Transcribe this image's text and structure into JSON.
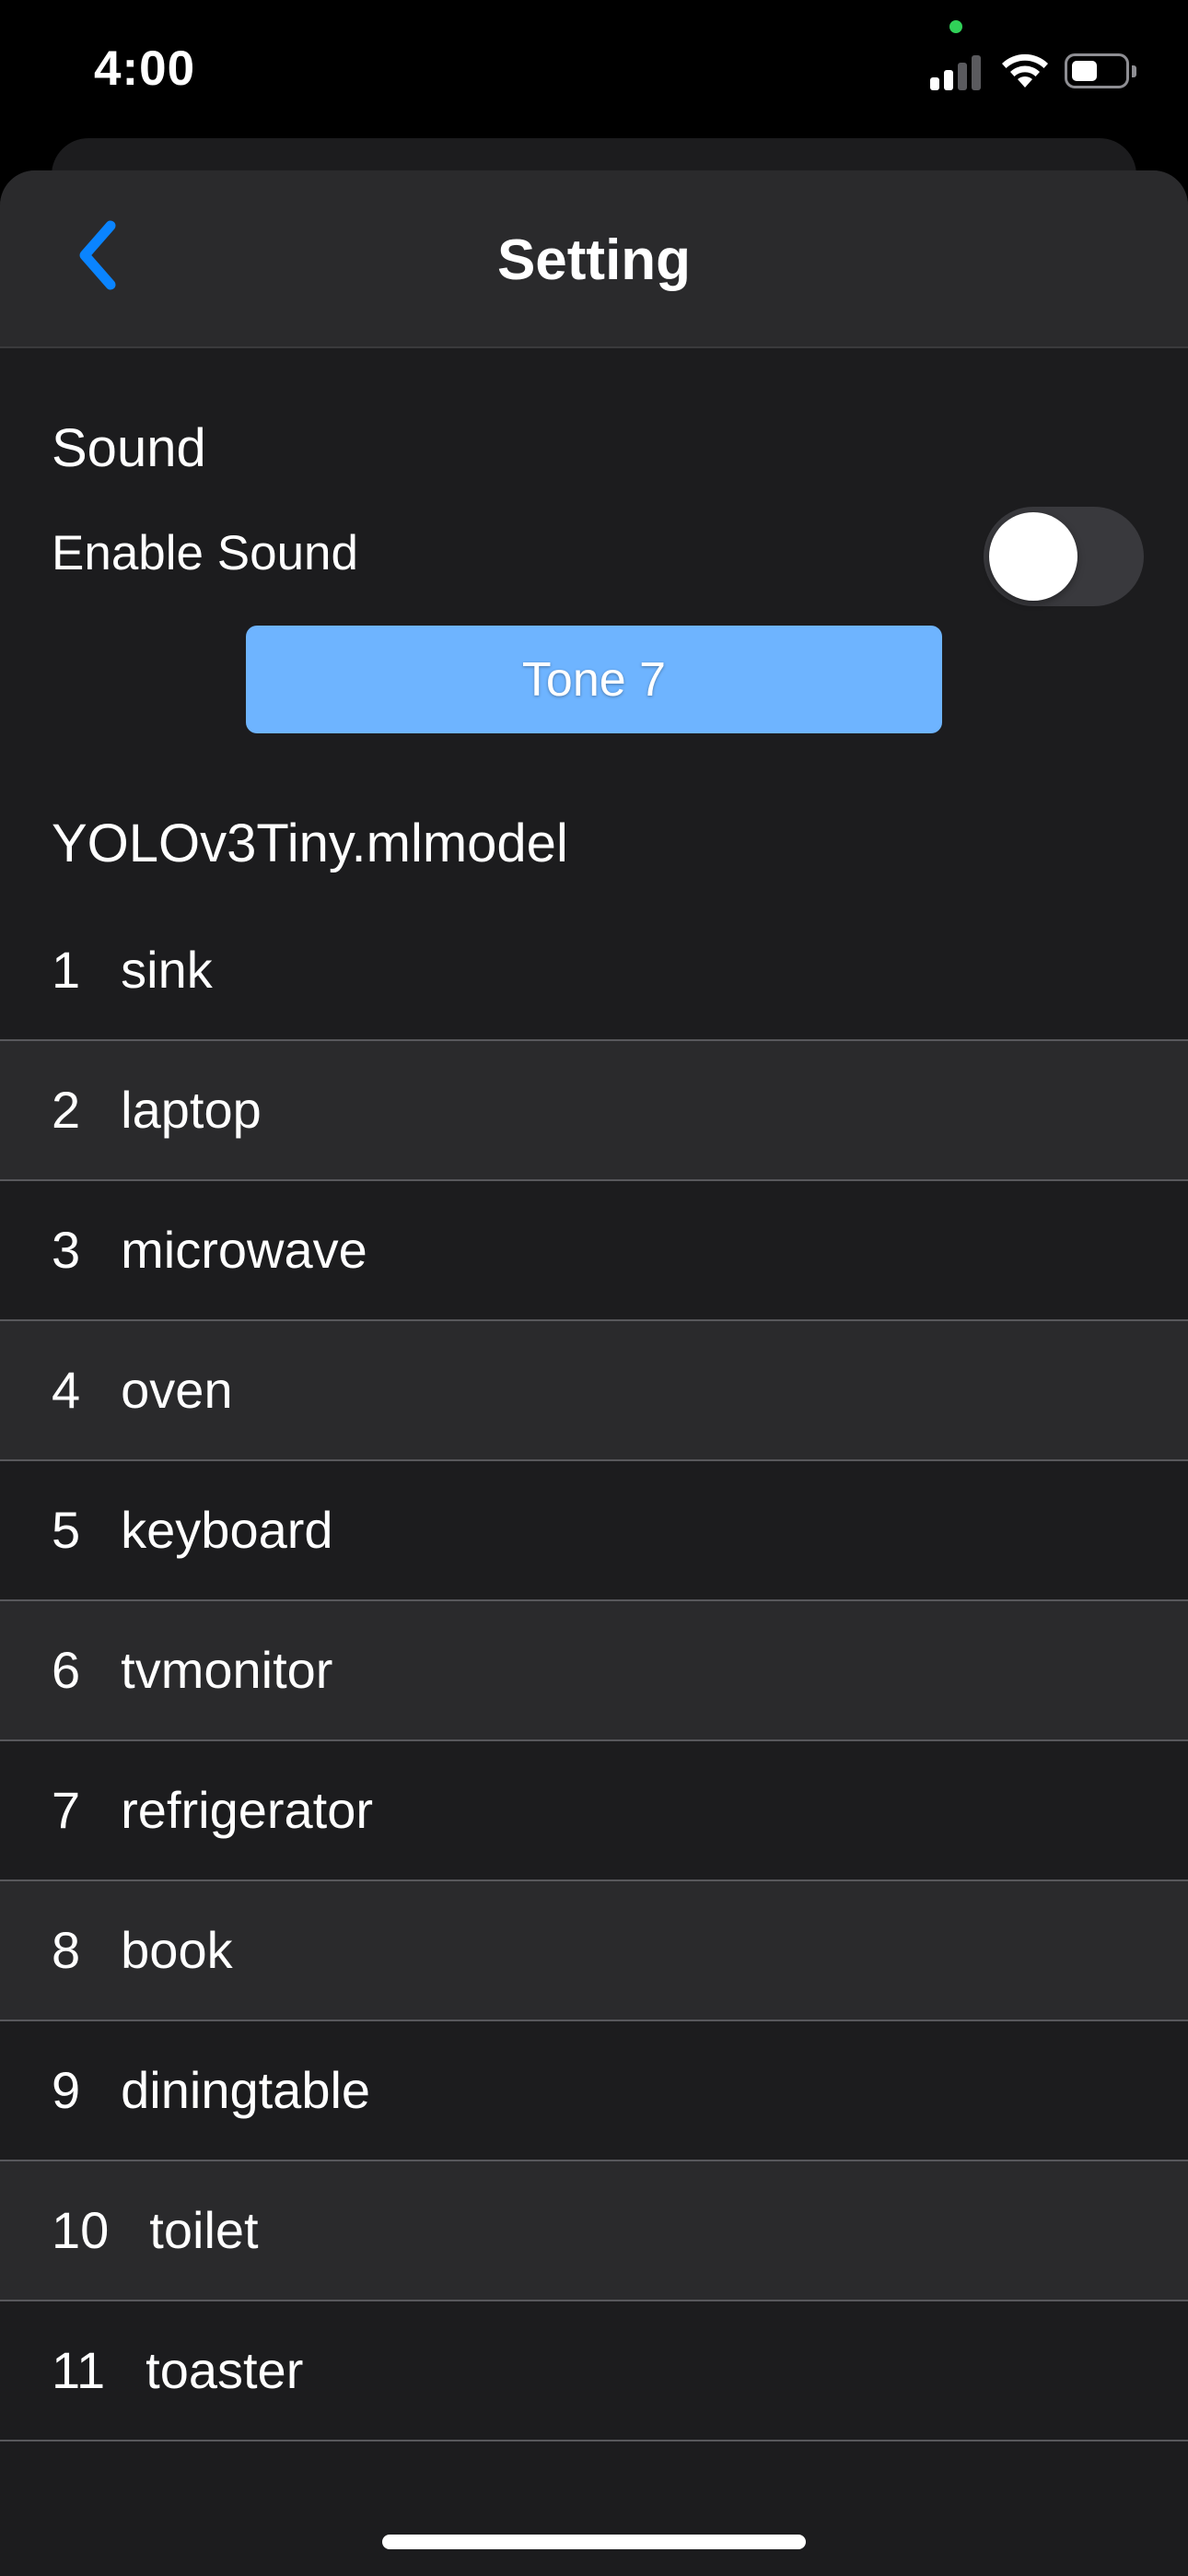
{
  "status_bar": {
    "time": "4:00",
    "privacy_dot_color": "#30d158",
    "signal_bars_active": 2,
    "signal_bars_total": 4,
    "battery_level": 0.5
  },
  "nav": {
    "title": "Setting",
    "back_icon": "chevron-left-icon",
    "accent_color": "#0a84ff"
  },
  "sound_section": {
    "title": "Sound",
    "toggle_label": "Enable Sound",
    "toggle_on": false,
    "tone_button_label": "Tone 7",
    "tone_button_color": "#6eb4ff"
  },
  "model": {
    "title": "YOLOv3Tiny.mlmodel"
  },
  "classes": [
    {
      "index": "1",
      "name": "sink"
    },
    {
      "index": "2",
      "name": "laptop"
    },
    {
      "index": "3",
      "name": "microwave"
    },
    {
      "index": "4",
      "name": "oven"
    },
    {
      "index": "5",
      "name": "keyboard"
    },
    {
      "index": "6",
      "name": "tvmonitor"
    },
    {
      "index": "7",
      "name": "refrigerator"
    },
    {
      "index": "8",
      "name": "book"
    },
    {
      "index": "9",
      "name": "diningtable"
    },
    {
      "index": "10",
      "name": "toilet"
    },
    {
      "index": "11",
      "name": "toaster"
    }
  ]
}
